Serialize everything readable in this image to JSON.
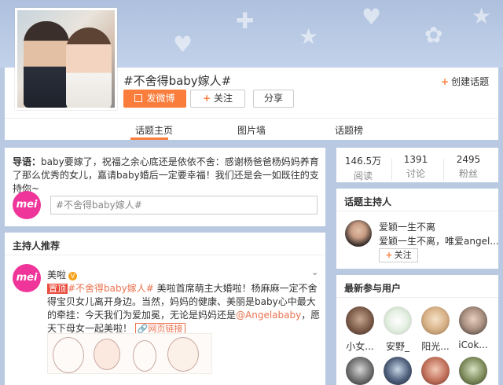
{
  "header": {
    "topic_title": "#不舍得baby嫁人#",
    "post_button": "发微博",
    "follow_button": "关注",
    "share_button": "分享",
    "create_topic": "创建话题"
  },
  "tabs": [
    {
      "label": "话题主页",
      "active": true
    },
    {
      "label": "图片墙",
      "active": false
    },
    {
      "label": "话题榜",
      "active": false
    }
  ],
  "intro": {
    "label": "导语：",
    "text": "baby要嫁了，祝福之余心底还是依依不舍：感谢杨爸爸杨妈妈养育了那么优秀的女儿，嘉请baby婚后一定要幸福！我们还是会一如既往的支持你~"
  },
  "composer": {
    "logo": "mei",
    "value": "#不舍得baby嫁人#"
  },
  "host_recommend": {
    "heading": "主持人推荐",
    "post": {
      "logo": "mei",
      "author": "美啦",
      "top_tag": "置顶",
      "topic": "#不舍得baby嫁人#",
      "text1": "美啦首席萌主大婚啦！杨麻麻一定不舍得宝贝女儿离开身边。当然，妈妈的健康、美丽是baby心中最大的牵挂：今天我们为爱加冕，无论是妈妈还是",
      "mention": "@Angelababy",
      "text2": "，愿天下母女一起美啦！",
      "web_link": "网页链接"
    }
  },
  "stats": [
    {
      "value": "146.5万",
      "label": "阅读"
    },
    {
      "value": "1391",
      "label": "讨论"
    },
    {
      "value": "2495",
      "label": "粉丝"
    }
  ],
  "host": {
    "heading": "话题主持人",
    "name": "爱颖一生不离",
    "desc": "爱颖一生不离，唯爱angel...",
    "follow": "关注"
  },
  "new_users": {
    "heading": "最新参与用户",
    "row1": [
      "小女...",
      "安野_",
      "阳光...",
      "iCok..."
    ]
  },
  "colors": {
    "accent": "#fa7d3c",
    "link": "#eb7350",
    "mei_pink": "#f0359a"
  }
}
